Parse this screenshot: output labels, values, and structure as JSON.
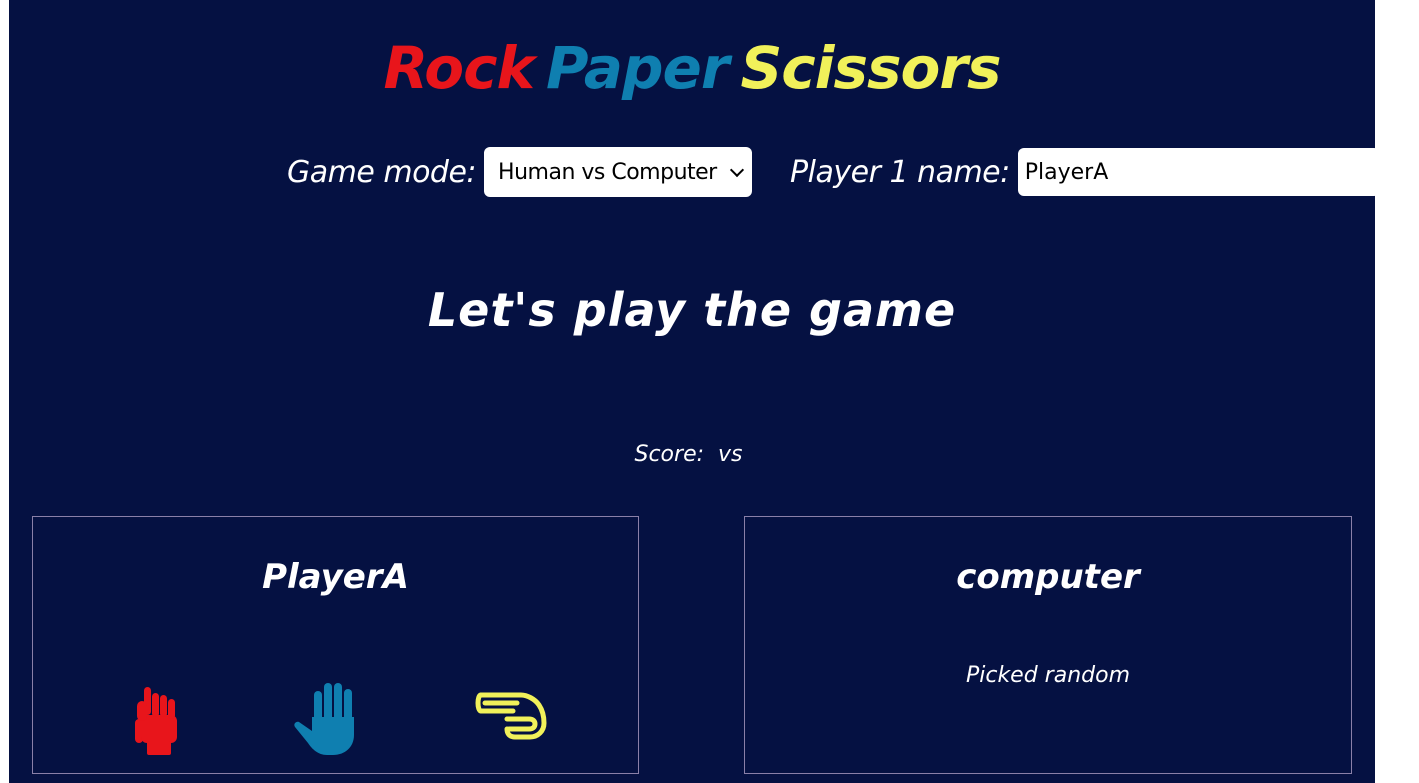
{
  "header": {
    "title_words": [
      {
        "text": "Rock",
        "color": "#e8151b"
      },
      {
        "text": "Paper",
        "color": "#0f7fb0"
      },
      {
        "text": "Scissors",
        "color": "#f1f15a"
      }
    ]
  },
  "controls": {
    "game_mode_label": "Game mode:",
    "game_mode_value": "Human vs Computer",
    "player1_label": "Player 1 name:",
    "player1_value": "PlayerA"
  },
  "main": {
    "heading": "Let's play the game",
    "score_text": "Score:  vs "
  },
  "players": {
    "left": {
      "name": "PlayerA",
      "choices": [
        {
          "name": "rock",
          "icon": "fist-icon",
          "color": "#e8151b"
        },
        {
          "name": "paper",
          "icon": "open-hand-icon",
          "color": "#0f7fb0"
        },
        {
          "name": "scissors",
          "icon": "scissors-hand-icon",
          "color": "#f1f15a"
        }
      ]
    },
    "right": {
      "name": "computer",
      "status": "Picked random"
    }
  }
}
